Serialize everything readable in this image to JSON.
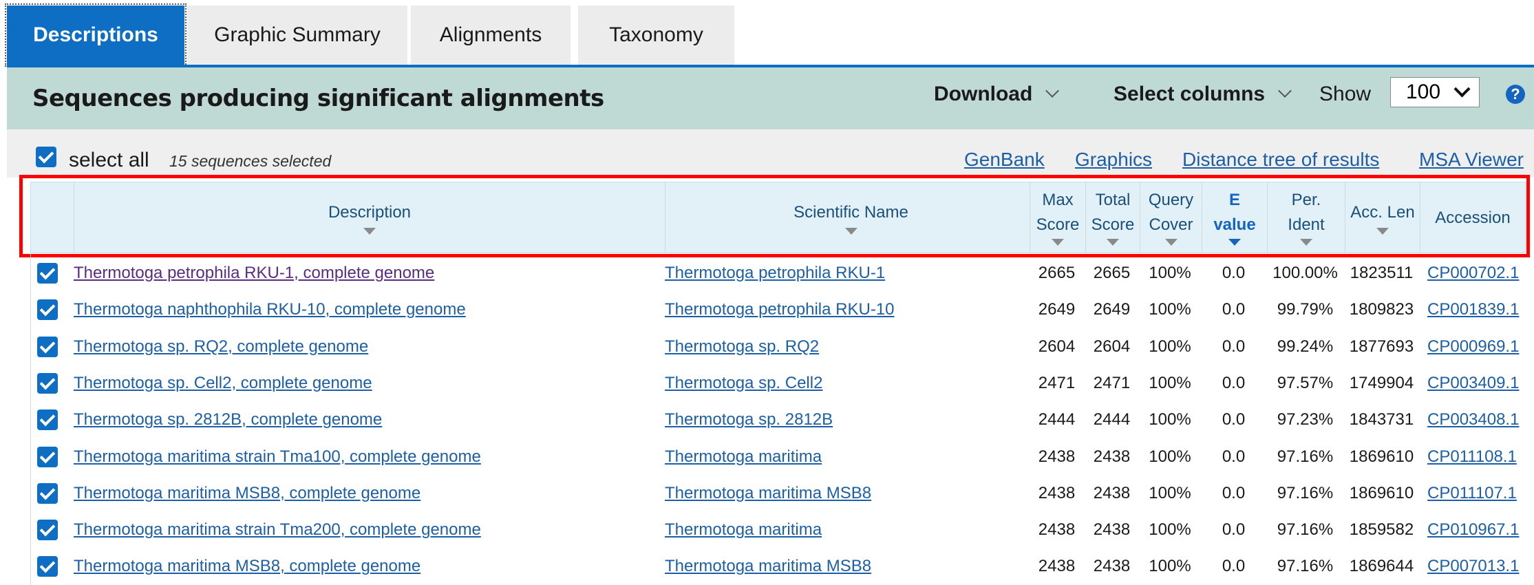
{
  "tabs": [
    {
      "label": "Descriptions",
      "active": true
    },
    {
      "label": "Graphic Summary",
      "active": false
    },
    {
      "label": "Alignments",
      "active": false
    },
    {
      "label": "Taxonomy",
      "active": false
    }
  ],
  "header": {
    "title": "Sequences producing significant alignments",
    "download_label": "Download",
    "select_columns_label": "Select columns",
    "show_label": "Show",
    "show_value": "100",
    "help_glyph": "?"
  },
  "selection": {
    "select_all_label": "select all",
    "count_text": "15 sequences selected"
  },
  "links": {
    "genbank": "GenBank",
    "graphics": "Graphics",
    "distance_tree": "Distance tree of results",
    "msa_viewer": "MSA Viewer"
  },
  "columns": {
    "description": "Description",
    "scientific_name": "Scientific Name",
    "max_score": [
      "Max",
      "Score"
    ],
    "total_score": [
      "Total",
      "Score"
    ],
    "query_cover": [
      "Query",
      "Cover"
    ],
    "e_value": [
      "E",
      "value"
    ],
    "per_ident": [
      "Per.",
      "Ident"
    ],
    "acc_len": "Acc. Len",
    "accession": "Accession"
  },
  "rows": [
    {
      "description": "Thermotoga petrophila RKU-1, complete genome",
      "sci_name": "Thermotoga petrophila RKU-1",
      "max": "2665",
      "total": "2665",
      "cover": "100%",
      "evalue": "0.0",
      "ident": "100.00%",
      "len": "1823511",
      "acc": "CP000702.1"
    },
    {
      "description": "Thermotoga naphthophila RKU-10, complete genome",
      "sci_name": "Thermotoga petrophila RKU-10",
      "max": "2649",
      "total": "2649",
      "cover": "100%",
      "evalue": "0.0",
      "ident": "99.79%",
      "len": "1809823",
      "acc": "CP001839.1"
    },
    {
      "description": "Thermotoga sp. RQ2, complete genome",
      "sci_name": "Thermotoga sp. RQ2",
      "max": "2604",
      "total": "2604",
      "cover": "100%",
      "evalue": "0.0",
      "ident": "99.24%",
      "len": "1877693",
      "acc": "CP000969.1"
    },
    {
      "description": "Thermotoga sp. Cell2, complete genome",
      "sci_name": "Thermotoga sp. Cell2",
      "max": "2471",
      "total": "2471",
      "cover": "100%",
      "evalue": "0.0",
      "ident": "97.57%",
      "len": "1749904",
      "acc": "CP003409.1"
    },
    {
      "description": "Thermotoga sp. 2812B, complete genome",
      "sci_name": "Thermotoga sp. 2812B",
      "max": "2444",
      "total": "2444",
      "cover": "100%",
      "evalue": "0.0",
      "ident": "97.23%",
      "len": "1843731",
      "acc": "CP003408.1"
    },
    {
      "description": "Thermotoga maritima strain Tma100, complete genome",
      "sci_name": "Thermotoga maritima",
      "max": "2438",
      "total": "2438",
      "cover": "100%",
      "evalue": "0.0",
      "ident": "97.16%",
      "len": "1869610",
      "acc": "CP011108.1"
    },
    {
      "description": "Thermotoga maritima MSB8, complete genome",
      "sci_name": "Thermotoga maritima MSB8",
      "max": "2438",
      "total": "2438",
      "cover": "100%",
      "evalue": "0.0",
      "ident": "97.16%",
      "len": "1869610",
      "acc": "CP011107.1"
    },
    {
      "description": "Thermotoga maritima strain Tma200, complete genome",
      "sci_name": "Thermotoga maritima",
      "max": "2438",
      "total": "2438",
      "cover": "100%",
      "evalue": "0.0",
      "ident": "97.16%",
      "len": "1859582",
      "acc": "CP010967.1"
    },
    {
      "description": "Thermotoga maritima MSB8, complete genome",
      "sci_name": "Thermotoga maritima MSB8",
      "max": "2438",
      "total": "2438",
      "cover": "100%",
      "evalue": "0.0",
      "ident": "97.16%",
      "len": "1869644",
      "acc": "CP007013.1"
    }
  ]
}
